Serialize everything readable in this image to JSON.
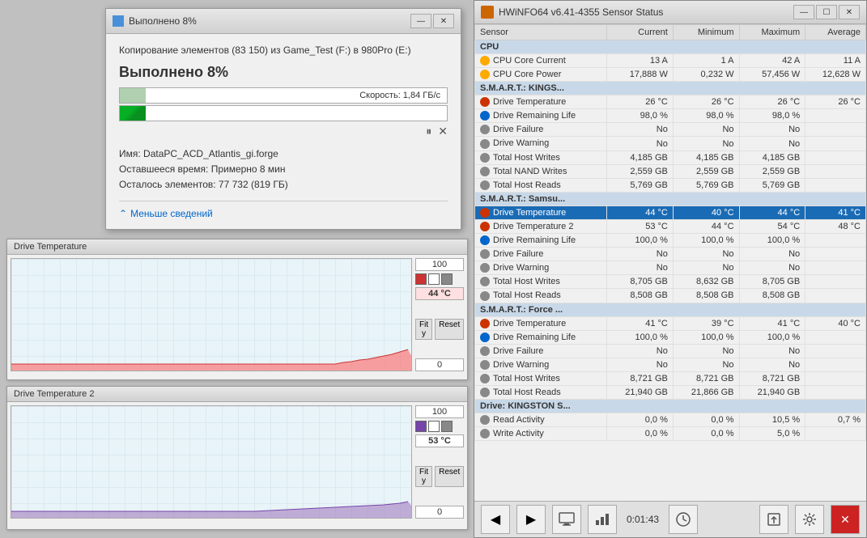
{
  "copy_dialog": {
    "title": "Выполнено 8%",
    "source_line": "Копирование элементов (83 150) из Game_Test (F:) в 980Pro (E:)",
    "progress_label": "Выполнено 8%",
    "speed_label": "Скорость: 1,84 ГБ/с",
    "file_name_label": "Имя: DataPC_ACD_Atlantis_gi.forge",
    "time_remaining_label": "Оставшееся время: Примерно 8 мин",
    "items_remaining_label": "Осталось элементов: 77 732 (819 ГБ)",
    "details_btn": "Меньше сведений",
    "pause_icon": "⏸",
    "close_icon": "✕"
  },
  "graph1": {
    "title": "Drive Temperature",
    "value_top": "100",
    "value_current": "44 °C",
    "value_bottom": "0",
    "fit_btn": "Fit y",
    "reset_btn": "Reset"
  },
  "graph2": {
    "title": "Drive Temperature 2",
    "value_top": "100",
    "value_current": "53 °C",
    "value_bottom": "0",
    "fit_btn": "Fit y",
    "reset_btn": "Reset"
  },
  "hwinfo": {
    "title": "HWiNFO64 v6.41-4355 Sensor Status",
    "columns": [
      "Sensor",
      "Current",
      "Minimum",
      "Maximum",
      "Average"
    ],
    "toolbar_time": "0:01:43",
    "groups": [
      {
        "name": "CPU",
        "rows": [
          {
            "name": "CPU Core Current",
            "current": "13 A",
            "minimum": "1 A",
            "maximum": "42 A",
            "average": "11 A",
            "highlighted": false
          },
          {
            "name": "CPU Core Power",
            "current": "17,888 W",
            "minimum": "0,232 W",
            "maximum": "57,456 W",
            "average": "12,628 W",
            "highlighted": false
          }
        ]
      },
      {
        "name": "S.M.A.R.T.: KINGS...",
        "rows": [
          {
            "name": "Drive Temperature",
            "current": "26 °C",
            "minimum": "26 °C",
            "maximum": "26 °C",
            "average": "26 °C",
            "highlighted": false
          },
          {
            "name": "Drive Remaining Life",
            "current": "98,0 %",
            "minimum": "98,0 %",
            "maximum": "98,0 %",
            "average": "",
            "highlighted": false
          },
          {
            "name": "Drive Failure",
            "current": "No",
            "minimum": "No",
            "maximum": "No",
            "average": "",
            "highlighted": false
          },
          {
            "name": "Drive Warning",
            "current": "No",
            "minimum": "No",
            "maximum": "No",
            "average": "",
            "highlighted": false
          },
          {
            "name": "Total Host Writes",
            "current": "4,185 GB",
            "minimum": "4,185 GB",
            "maximum": "4,185 GB",
            "average": "",
            "highlighted": false
          },
          {
            "name": "Total NAND Writes",
            "current": "2,559 GB",
            "minimum": "2,559 GB",
            "maximum": "2,559 GB",
            "average": "",
            "highlighted": false
          },
          {
            "name": "Total Host Reads",
            "current": "5,769 GB",
            "minimum": "5,769 GB",
            "maximum": "5,769 GB",
            "average": "",
            "highlighted": false
          }
        ]
      },
      {
        "name": "S.M.A.R.T.: Samsu...",
        "rows": [
          {
            "name": "Drive Temperature",
            "current": "44 °C",
            "minimum": "40 °C",
            "maximum": "44 °C",
            "average": "41 °C",
            "highlighted": true
          },
          {
            "name": "Drive Temperature 2",
            "current": "53 °C",
            "minimum": "44 °C",
            "maximum": "54 °C",
            "average": "48 °C",
            "highlighted": false
          },
          {
            "name": "Drive Remaining Life",
            "current": "100,0 %",
            "minimum": "100,0 %",
            "maximum": "100,0 %",
            "average": "",
            "highlighted": false
          },
          {
            "name": "Drive Failure",
            "current": "No",
            "minimum": "No",
            "maximum": "No",
            "average": "",
            "highlighted": false
          },
          {
            "name": "Drive Warning",
            "current": "No",
            "minimum": "No",
            "maximum": "No",
            "average": "",
            "highlighted": false
          },
          {
            "name": "Total Host Writes",
            "current": "8,705 GB",
            "minimum": "8,632 GB",
            "maximum": "8,705 GB",
            "average": "",
            "highlighted": false
          },
          {
            "name": "Total Host Reads",
            "current": "8,508 GB",
            "minimum": "8,508 GB",
            "maximum": "8,508 GB",
            "average": "",
            "highlighted": false
          }
        ]
      },
      {
        "name": "S.M.A.R.T.: Force ...",
        "rows": [
          {
            "name": "Drive Temperature",
            "current": "41 °C",
            "minimum": "39 °C",
            "maximum": "41 °C",
            "average": "40 °C",
            "highlighted": false
          },
          {
            "name": "Drive Remaining Life",
            "current": "100,0 %",
            "minimum": "100,0 %",
            "maximum": "100,0 %",
            "average": "",
            "highlighted": false
          },
          {
            "name": "Drive Failure",
            "current": "No",
            "minimum": "No",
            "maximum": "No",
            "average": "",
            "highlighted": false
          },
          {
            "name": "Drive Warning",
            "current": "No",
            "minimum": "No",
            "maximum": "No",
            "average": "",
            "highlighted": false
          },
          {
            "name": "Total Host Writes",
            "current": "8,721 GB",
            "minimum": "8,721 GB",
            "maximum": "8,721 GB",
            "average": "",
            "highlighted": false
          },
          {
            "name": "Total Host Reads",
            "current": "21,940 GB",
            "minimum": "21,866 GB",
            "maximum": "21,940 GB",
            "average": "",
            "highlighted": false
          }
        ]
      },
      {
        "name": "Drive: KINGSTON S...",
        "rows": [
          {
            "name": "Read Activity",
            "current": "0,0 %",
            "minimum": "0,0 %",
            "maximum": "10,5 %",
            "average": "0,7 %",
            "highlighted": false
          },
          {
            "name": "Write Activity",
            "current": "0,0 %",
            "minimum": "0,0 %",
            "maximum": "5,0 %",
            "average": "",
            "highlighted": false
          }
        ]
      }
    ],
    "toolbar_buttons": [
      {
        "name": "back-btn",
        "icon": "◀"
      },
      {
        "name": "forward-btn",
        "icon": "▶"
      },
      {
        "name": "monitor-btn",
        "icon": "🖥"
      },
      {
        "name": "chart-btn",
        "icon": "📊"
      },
      {
        "name": "clock-btn",
        "icon": "🕐"
      },
      {
        "name": "export-btn",
        "icon": "📤"
      },
      {
        "name": "settings-btn",
        "icon": "⚙"
      },
      {
        "name": "close-btn",
        "icon": "✕"
      }
    ]
  }
}
